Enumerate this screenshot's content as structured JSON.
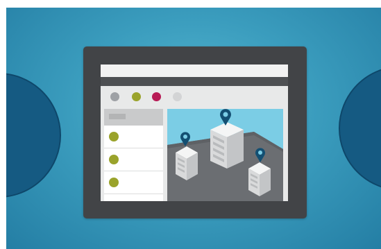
{
  "colors": {
    "background_center": "#56b8d1",
    "background_edge": "#247ea4",
    "side_circle": "#155a82",
    "device_frame": "#424447",
    "screen": "#e8e9e9",
    "sky": "#7bcde5",
    "ground": "#6b6e72",
    "pin": "#134f72"
  },
  "toolbar": {
    "dots": [
      {
        "name": "gray-dot",
        "color": "#9ea1a5"
      },
      {
        "name": "olive-dot",
        "color": "#9aa32b"
      },
      {
        "name": "crimson-dot",
        "color": "#b71a54"
      },
      {
        "name": "light-gray-dot",
        "color": "#d3d4d5"
      }
    ]
  },
  "sidebar": {
    "items": [
      {
        "bullet_color": "#9aa32b"
      },
      {
        "bullet_color": "#9aa32b"
      },
      {
        "bullet_color": "#9aa32b"
      }
    ]
  },
  "map": {
    "buildings": [
      {
        "name": "left-building",
        "pin_icon": "map-pin-icon"
      },
      {
        "name": "center-building",
        "pin_icon": "map-pin-icon"
      },
      {
        "name": "right-building",
        "pin_icon": "map-pin-icon"
      }
    ]
  },
  "side_buttons": {
    "left_icon": "plus-icon",
    "right_icon": "none"
  }
}
